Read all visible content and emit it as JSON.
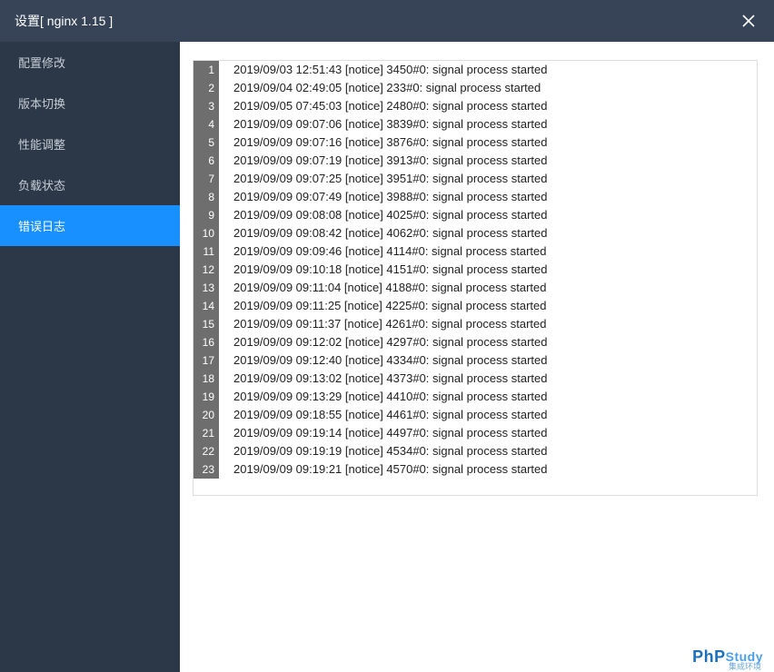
{
  "titlebar": {
    "title": "设置[ nginx 1.15 ]"
  },
  "sidebar": {
    "items": [
      {
        "label": "配置修改",
        "active": false
      },
      {
        "label": "版本切换",
        "active": false
      },
      {
        "label": "性能调整",
        "active": false
      },
      {
        "label": "负载状态",
        "active": false
      },
      {
        "label": "错误日志",
        "active": true
      }
    ]
  },
  "log": {
    "lines": [
      "2019/09/03 12:51:43 [notice] 3450#0: signal process started",
      "2019/09/04 02:49:05 [notice] 233#0: signal process started",
      "2019/09/05 07:45:03 [notice] 2480#0: signal process started",
      "2019/09/09 09:07:06 [notice] 3839#0: signal process started",
      "2019/09/09 09:07:16 [notice] 3876#0: signal process started",
      "2019/09/09 09:07:19 [notice] 3913#0: signal process started",
      "2019/09/09 09:07:25 [notice] 3951#0: signal process started",
      "2019/09/09 09:07:49 [notice] 3988#0: signal process started",
      "2019/09/09 09:08:08 [notice] 4025#0: signal process started",
      "2019/09/09 09:08:42 [notice] 4062#0: signal process started",
      "2019/09/09 09:09:46 [notice] 4114#0: signal process started",
      "2019/09/09 09:10:18 [notice] 4151#0: signal process started",
      "2019/09/09 09:11:04 [notice] 4188#0: signal process started",
      "2019/09/09 09:11:25 [notice] 4225#0: signal process started",
      "2019/09/09 09:11:37 [notice] 4261#0: signal process started",
      "2019/09/09 09:12:02 [notice] 4297#0: signal process started",
      "2019/09/09 09:12:40 [notice] 4334#0: signal process started",
      "2019/09/09 09:13:02 [notice] 4373#0: signal process started",
      "2019/09/09 09:13:29 [notice] 4410#0: signal process started",
      "2019/09/09 09:18:55 [notice] 4461#0: signal process started",
      "2019/09/09 09:19:14 [notice] 4497#0: signal process started",
      "2019/09/09 09:19:19 [notice] 4534#0: signal process started",
      "2019/09/09 09:19:21 [notice] 4570#0: signal process started"
    ]
  },
  "footer": {
    "brand_main": "PhP",
    "brand_sub": "Study",
    "brand_tag": "集成环境"
  }
}
